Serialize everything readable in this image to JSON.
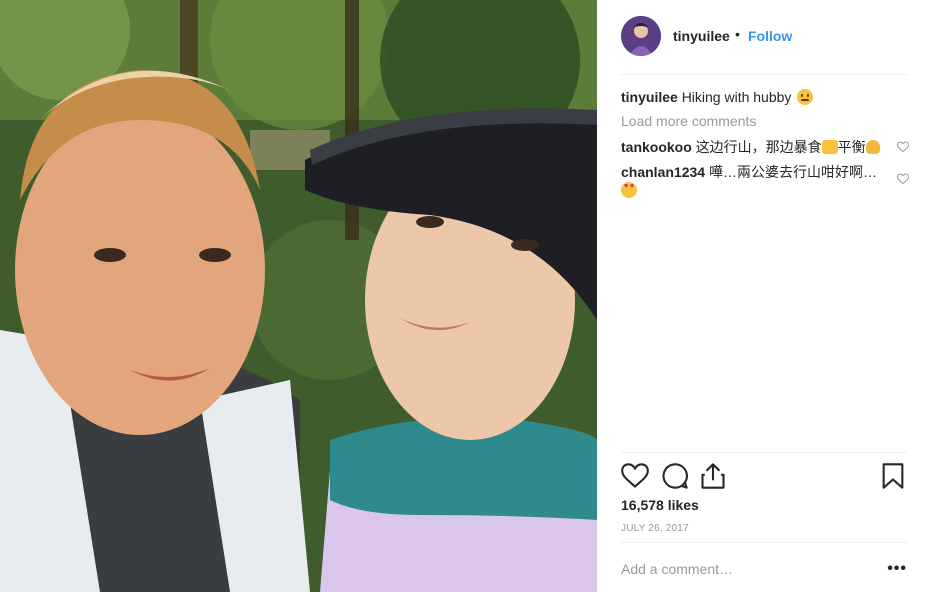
{
  "post": {
    "photo_alt": "selfie photo of two people hiking",
    "author": {
      "username": "tinyuilee",
      "separator": "•",
      "follow_label": "Follow",
      "avatar_icon": "user-avatar"
    },
    "caption": {
      "username": "tinyuilee",
      "text": "Hiking with hubby",
      "emoji": "grimacing-face-emoji"
    },
    "load_more_label": "Load more comments",
    "comments": [
      {
        "username": "tankookoo",
        "text": "这边行山，那边暴食",
        "text2": "平衡",
        "emojis": [
          "thumbs-up-emoji",
          "clapping-hands-emoji"
        ]
      },
      {
        "username": "chanlan1234",
        "text": "嘩…兩公婆去行山咁好啊…",
        "emojis": [
          "heart-eyes-emoji"
        ]
      }
    ],
    "likes": "16,578 likes",
    "date": "JULY 26, 2017",
    "add_comment_placeholder": "Add a comment…",
    "more_options_label": "•••"
  },
  "icons": {
    "like": "heart-icon",
    "comment": "comment-icon",
    "share": "share-icon",
    "save": "bookmark-icon"
  },
  "colors": {
    "follow_blue": "#3897f0",
    "muted_text": "#999999",
    "text": "#262626",
    "divider": "#efefef"
  }
}
